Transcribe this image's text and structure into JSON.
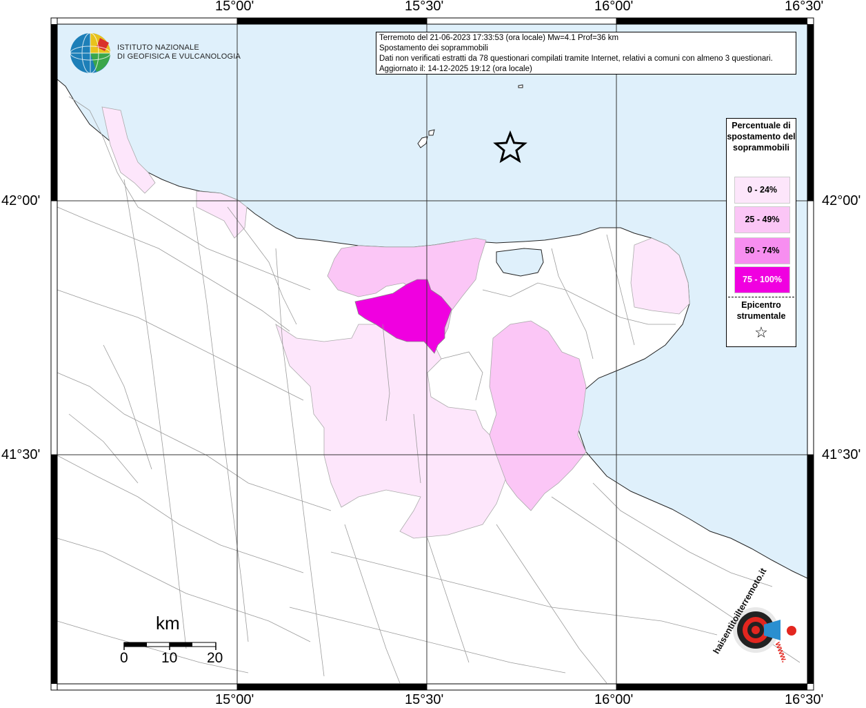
{
  "logo": {
    "name": "inGV-logo",
    "line1": "ISTITUTO NAZIONALE",
    "line2": "DI GEOFISICA E VULCANOLOGIA"
  },
  "info": {
    "line1": "Terremoto del 21-06-2023 17:33:53 (ora locale) Mw=4.1 Prof=36 km",
    "line2": "Spostamento dei soprammobili",
    "line3": "Dati non verificati estratti da 78 questionari compilati tramite Internet, relativi a comuni con almeno 3 questionari.",
    "line4": "Aggiornato il: 14-12-2025 19:12 (ora locale)"
  },
  "legend": {
    "title": "Percentuale di spostamento del soprammobili",
    "classes": [
      {
        "label": "0 - 24%",
        "color": "#fde6fb"
      },
      {
        "label": "25 - 49%",
        "color": "#fbc6f6"
      },
      {
        "label": "50 - 74%",
        "color": "#f78ef0"
      },
      {
        "label": "75 - 100%",
        "color": "#f000e0"
      }
    ],
    "epicenter_label": "Epicentro strumentale",
    "star_icon": "star-icon"
  },
  "coords": {
    "top": [
      "15°00'",
      "15°30'",
      "16°00'",
      "16°30'"
    ],
    "bottom": [
      "15°00'",
      "15°30'",
      "16°00'",
      "16°30'"
    ],
    "left": [
      "42°00'",
      "41°30'"
    ],
    "right": [
      "42°00'",
      "41°30'"
    ]
  },
  "scalebar": {
    "unit": "km",
    "labels": [
      "0",
      "10",
      "20"
    ]
  },
  "watermark": {
    "text": "haisentitoilterremoto.it",
    "url": "www."
  },
  "colors": {
    "sea": "#dff0fb",
    "land": "#ffffff",
    "border": "#999999"
  }
}
